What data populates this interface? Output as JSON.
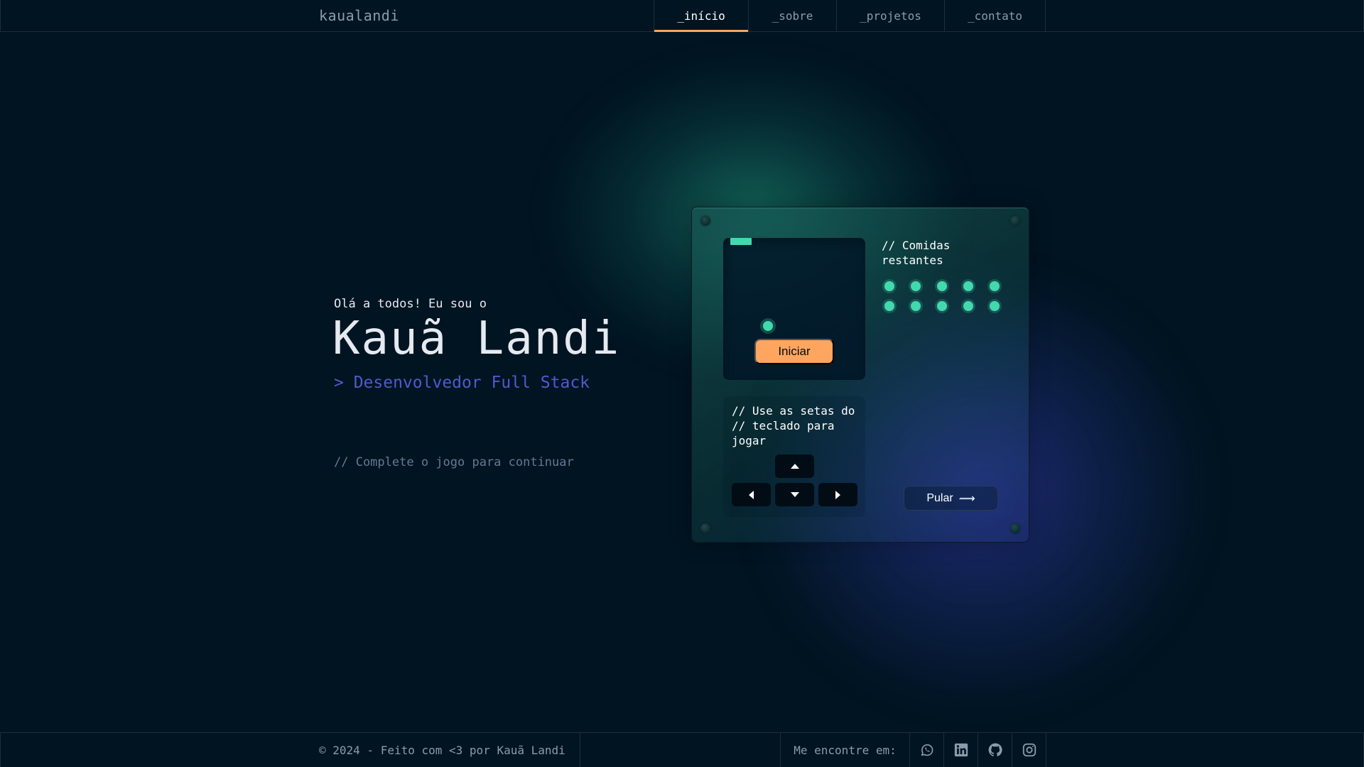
{
  "header": {
    "logo": "kaualandi",
    "nav": [
      {
        "label": "_início",
        "active": true
      },
      {
        "label": "_sobre",
        "active": false
      },
      {
        "label": "_projetos",
        "active": false
      },
      {
        "label": "_contato",
        "active": false
      }
    ]
  },
  "hero": {
    "greeting": "Olá a todos! Eu sou o",
    "name": "Kauã Landi",
    "role": "> Desenvolvedor Full Stack",
    "hint": "// Complete o jogo para continuar"
  },
  "game": {
    "start_label": "Iniciar",
    "controls_text": "// Use as setas do\n// teclado para\njogar",
    "food_title": "// Comidas restantes",
    "food_remaining": 10,
    "skip_label": "Pular",
    "skip_icon": "⟿"
  },
  "footer": {
    "copyright": "© 2024 - Feito com <3 por Kauã Landi",
    "social_label": "Me encontre em:",
    "social": [
      {
        "name": "whatsapp-icon"
      },
      {
        "name": "linkedin-icon"
      },
      {
        "name": "github-icon"
      },
      {
        "name": "instagram-icon"
      }
    ]
  },
  "colors": {
    "background": "#011421",
    "accent_orange": "#fea55f",
    "accent_green": "#43d9ad",
    "accent_blue": "#4d5bce",
    "muted_text": "#8b9bab",
    "border": "#1e2d3d"
  }
}
